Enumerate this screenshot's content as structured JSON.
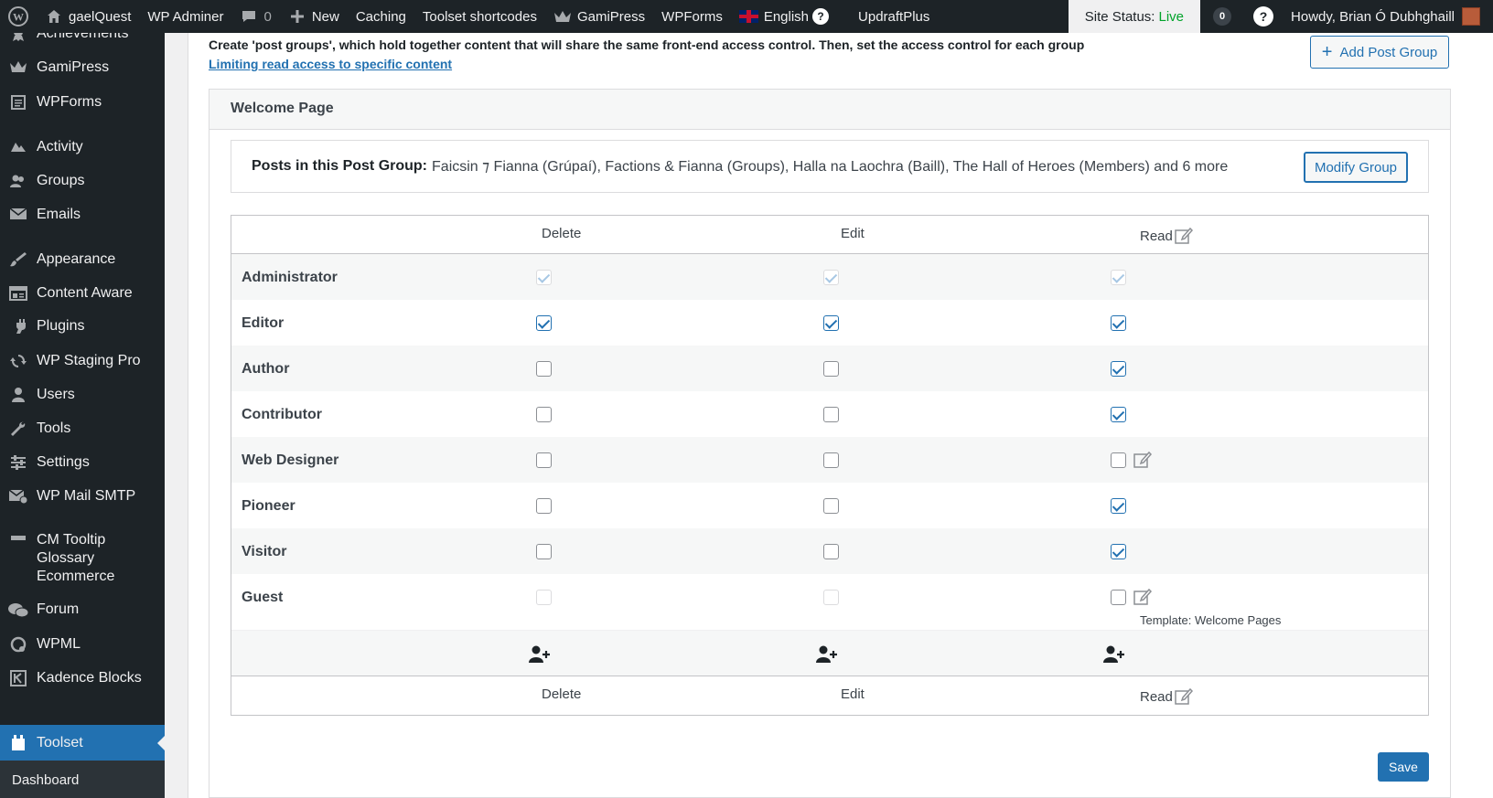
{
  "adminbar": {
    "site_name": "gaelQuest",
    "adminer": "WP Adminer",
    "comments_count": "0",
    "new_label": "New",
    "caching": "Caching",
    "toolset_shortcodes": "Toolset shortcodes",
    "gamipress": "GamiPress",
    "wpforms": "WPForms",
    "language": "English",
    "updraft": "UpdraftPlus",
    "site_status_label": "Site Status:",
    "site_status_value": "Live",
    "notifications": "0",
    "help": "?",
    "howdy": "Howdy, Brian Ó Dubhghaill"
  },
  "sidebar": {
    "items": [
      {
        "label": "Achievements",
        "icon": "achievements-icon"
      },
      {
        "label": "GamiPress",
        "icon": "crown-icon"
      },
      {
        "label": "WPForms",
        "icon": "form-icon"
      },
      {
        "label": "Activity",
        "icon": "activity-icon"
      },
      {
        "label": "Groups",
        "icon": "groups-icon"
      },
      {
        "label": "Emails",
        "icon": "email-icon"
      },
      {
        "label": "Appearance",
        "icon": "brush-icon"
      },
      {
        "label": "Content Aware",
        "icon": "layout-icon"
      },
      {
        "label": "Plugins",
        "icon": "plug-icon"
      },
      {
        "label": "WP Staging Pro",
        "icon": "sync-icon"
      },
      {
        "label": "Users",
        "icon": "user-icon"
      },
      {
        "label": "Tools",
        "icon": "wrench-icon"
      },
      {
        "label": "Settings",
        "icon": "settings-icon"
      },
      {
        "label": "WP Mail SMTP",
        "icon": "mail-smtp-icon"
      },
      {
        "label": "CM Tooltip Glossary Ecommerce",
        "icon": "tooltip-icon"
      },
      {
        "label": "Forum",
        "icon": "forum-icon"
      },
      {
        "label": "WPML",
        "icon": "wpml-icon"
      },
      {
        "label": "Kadence Blocks",
        "icon": "kadence-icon"
      },
      {
        "label": "Toolset",
        "icon": "toolset-icon"
      }
    ],
    "submenu_first": "Dashboard"
  },
  "main": {
    "intro": "Create 'post groups', which hold together content that will share the same front-end access control. Then, set the access control for each group",
    "intro_link": "Limiting read access to specific content",
    "add_button": "Add Post Group",
    "group": {
      "title": "Welcome Page",
      "posts_label": "Posts in this Post Group:",
      "posts_value": "Faicsin ⁊ Fianna (Grúpaí), Factions & Fianna (Groups), Halla na Laochra (Baill), The Hall of Heroes (Members) and 6 more",
      "modify_button": "Modify Group"
    },
    "table": {
      "columns": [
        "Delete",
        "Edit",
        "Read"
      ],
      "roles": [
        {
          "name": "Administrator",
          "delete": true,
          "edit": true,
          "read": true
        },
        {
          "name": "Editor",
          "delete": true,
          "edit": true,
          "read": true
        },
        {
          "name": "Author",
          "delete": false,
          "edit": false,
          "read": true
        },
        {
          "name": "Contributor",
          "delete": false,
          "edit": false,
          "read": true
        },
        {
          "name": "Web Designer",
          "delete": false,
          "edit": false,
          "read": false
        },
        {
          "name": "Pioneer",
          "delete": false,
          "edit": false,
          "read": true
        },
        {
          "name": "Visitor",
          "delete": false,
          "edit": false,
          "read": true
        },
        {
          "name": "Guest",
          "delete": false,
          "edit": false,
          "read": false
        }
      ],
      "guest_template_note": "Template: Welcome Pages"
    },
    "save_button": "Save"
  },
  "colors": {
    "accent": "#2271b1",
    "adminbar_bg": "#1d2327",
    "live": "#00a32a"
  }
}
